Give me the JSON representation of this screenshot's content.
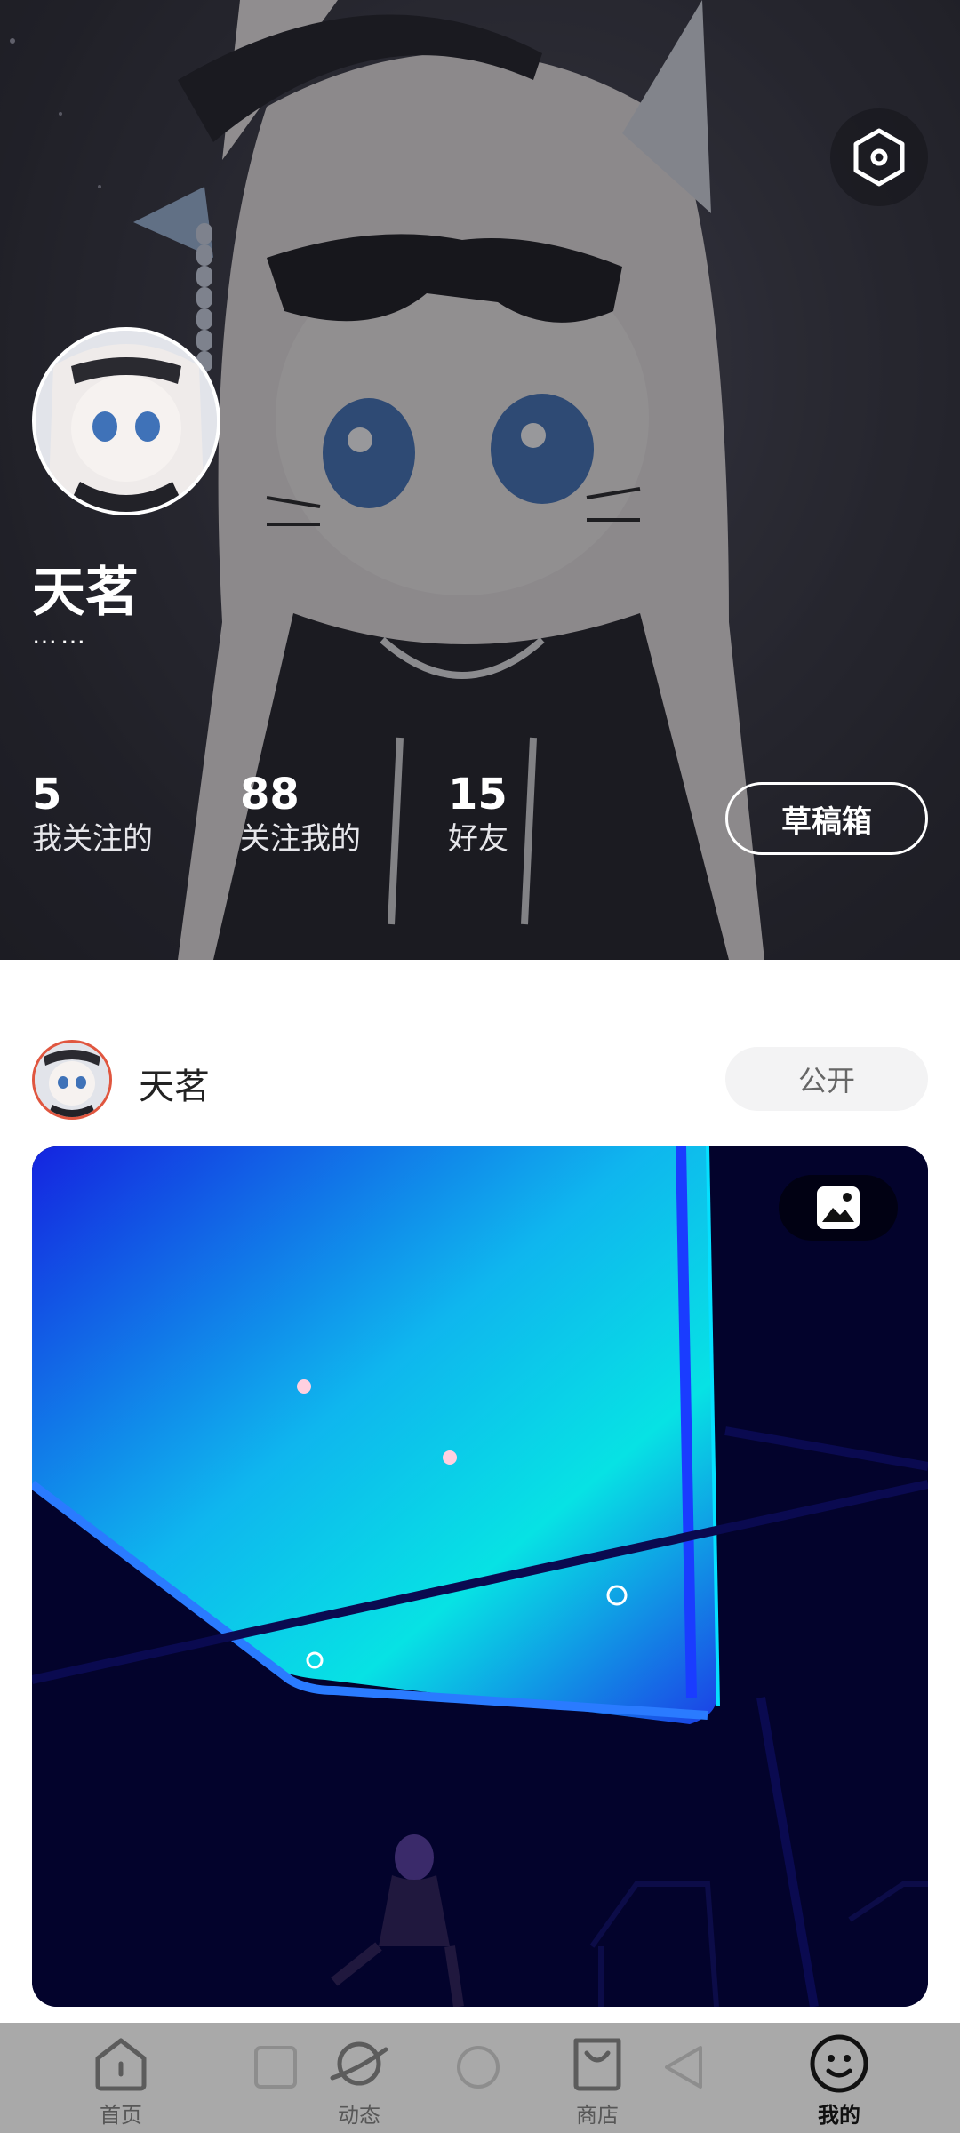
{
  "profile": {
    "name": "天茗",
    "bio": "……",
    "stats": [
      {
        "value": "5",
        "label": "我关注的"
      },
      {
        "value": "88",
        "label": "关注我的"
      },
      {
        "value": "15",
        "label": "好友"
      }
    ],
    "draft_button": "草稿箱"
  },
  "post": {
    "author": "天茗",
    "visibility": "公开",
    "image_badge_icon": "image-icon"
  },
  "tabbar": {
    "items": [
      {
        "label": "首页",
        "icon": "home-icon"
      },
      {
        "label": "动态",
        "icon": "planet-icon"
      },
      {
        "label": "商店",
        "icon": "shopping-bag-icon"
      },
      {
        "label": "我的",
        "icon": "smile-icon",
        "active": true
      }
    ]
  },
  "colors": {
    "accent_red": "#e0563f",
    "tabbar_bg": "#a9a9a9"
  }
}
